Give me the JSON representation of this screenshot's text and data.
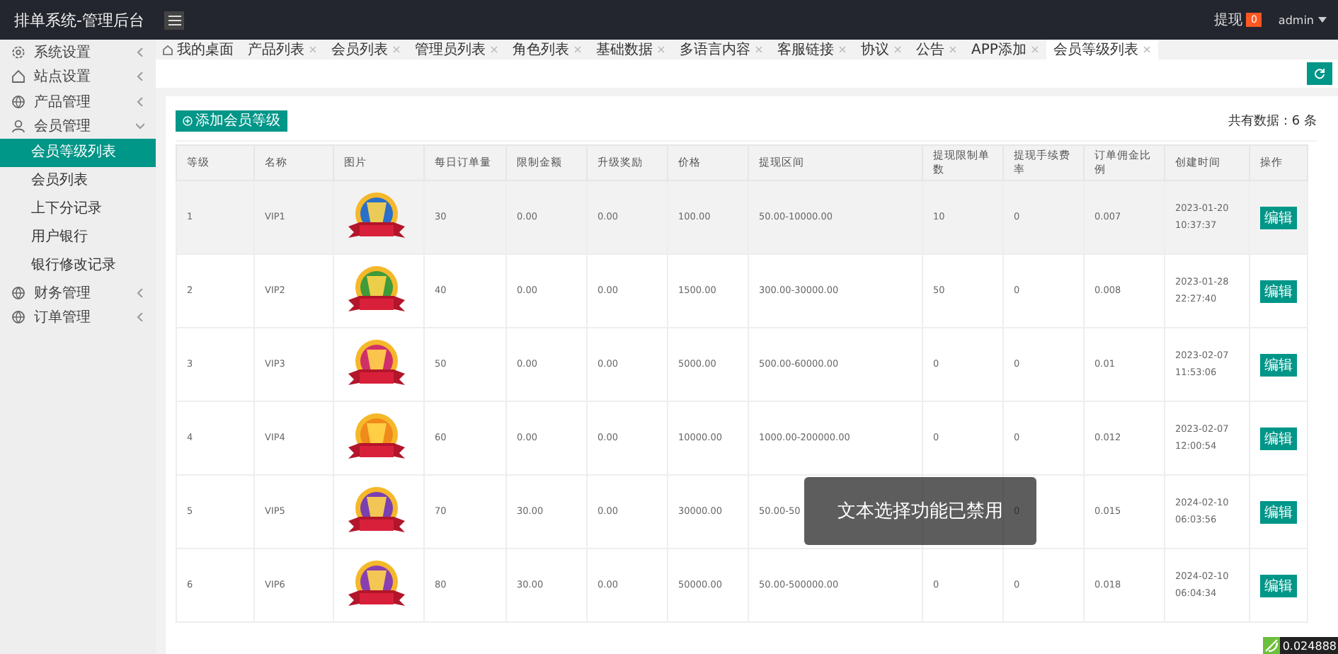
{
  "header": {
    "title": "排单系统-管理后台",
    "withdraw_label": "提现",
    "withdraw_badge": "0",
    "user": "admin"
  },
  "sidebar": {
    "items": [
      {
        "label": "系统设置",
        "expanded": false
      },
      {
        "label": "站点设置",
        "expanded": false
      },
      {
        "label": "产品管理",
        "expanded": false
      },
      {
        "label": "会员管理",
        "expanded": true,
        "children": [
          {
            "label": "会员等级列表",
            "selected": true
          },
          {
            "label": "会员列表",
            "selected": false
          },
          {
            "label": "上下分记录",
            "selected": false
          },
          {
            "label": "用户银行",
            "selected": false
          },
          {
            "label": "银行修改记录",
            "selected": false
          }
        ]
      },
      {
        "label": "财务管理",
        "expanded": false
      },
      {
        "label": "订单管理",
        "expanded": false
      }
    ]
  },
  "tabs": [
    {
      "label": "我的桌面",
      "selected": false,
      "closable": false
    },
    {
      "label": "产品列表",
      "selected": false,
      "closable": true
    },
    {
      "label": "会员列表",
      "selected": false,
      "closable": true
    },
    {
      "label": "管理员列表",
      "selected": false,
      "closable": true
    },
    {
      "label": "角色列表",
      "selected": false,
      "closable": true
    },
    {
      "label": "基础数据",
      "selected": false,
      "closable": true
    },
    {
      "label": "多语言内容",
      "selected": false,
      "closable": true
    },
    {
      "label": "客服链接",
      "selected": false,
      "closable": true
    },
    {
      "label": "协议",
      "selected": false,
      "closable": true
    },
    {
      "label": "公告",
      "selected": false,
      "closable": true
    },
    {
      "label": "APP添加",
      "selected": false,
      "closable": true
    },
    {
      "label": "会员等级列表",
      "selected": true,
      "closable": true
    }
  ],
  "add_button": "添加会员等级",
  "total": "共有数据：6 条",
  "table": {
    "columns": [
      "等级",
      "名称",
      "图片",
      "每日订单量",
      "限制金额",
      "升级奖励",
      "价格",
      "提现区间",
      "提现限制单数",
      "提现手续费率",
      "订单佣金比例",
      "创建时间",
      "操作"
    ],
    "rows": [
      {
        "selected": true,
        "level": "1",
        "name": "VIP1",
        "color": "#2a6fc9",
        "daily_orders": "30",
        "limit_amount": "0.00",
        "upgrade_reward": "0.00",
        "price": "100.00",
        "withdraw_range": "50.00-10000.00",
        "withdraw_limit_count": "10",
        "withdraw_fee_rate": "0",
        "commission_rate": "0.007",
        "created_at": "2023-01-20 10:37:37",
        "action": "编辑"
      },
      {
        "selected": false,
        "level": "2",
        "name": "VIP2",
        "color": "#3f9a3a",
        "daily_orders": "40",
        "limit_amount": "0.00",
        "upgrade_reward": "0.00",
        "price": "1500.00",
        "withdraw_range": "300.00-30000.00",
        "withdraw_limit_count": "50",
        "withdraw_fee_rate": "0",
        "commission_rate": "0.008",
        "created_at": "2023-01-28 22:27:40",
        "action": "编辑"
      },
      {
        "selected": false,
        "level": "3",
        "name": "VIP3",
        "color": "#d0306a",
        "daily_orders": "50",
        "limit_amount": "0.00",
        "upgrade_reward": "0.00",
        "price": "5000.00",
        "withdraw_range": "500.00-60000.00",
        "withdraw_limit_count": "0",
        "withdraw_fee_rate": "0",
        "commission_rate": "0.01",
        "created_at": "2023-02-07 11:53:06",
        "action": "编辑"
      },
      {
        "selected": false,
        "level": "4",
        "name": "VIP4",
        "color": "#f08a1a",
        "daily_orders": "60",
        "limit_amount": "0.00",
        "upgrade_reward": "0.00",
        "price": "10000.00",
        "withdraw_range": "1000.00-200000.00",
        "withdraw_limit_count": "0",
        "withdraw_fee_rate": "0",
        "commission_rate": "0.012",
        "created_at": "2023-02-07 12:00:54",
        "action": "编辑"
      },
      {
        "selected": false,
        "level": "5",
        "name": "VIP5",
        "color": "#7a3fb0",
        "daily_orders": "70",
        "limit_amount": "30.00",
        "upgrade_reward": "0.00",
        "price": "30000.00",
        "withdraw_range": "50.00-50",
        "withdraw_fee_rate": "0",
        "commission_rate": "0.015",
        "created_at": "2024-02-10 06:03:56",
        "action": "编辑"
      },
      {
        "selected": false,
        "level": "6",
        "name": "VIP6",
        "color": "#8a3fb0",
        "daily_orders": "80",
        "limit_amount": "30.00",
        "upgrade_reward": "0.00",
        "price": "50000.00",
        "withdraw_range": "50.00-500000.00",
        "withdraw_limit_count": "0",
        "withdraw_fee_rate": "0",
        "commission_rate": "0.018",
        "created_at": "2024-02-10 06:04:34",
        "action": "编辑"
      }
    ]
  },
  "toast": "文本选择功能已禁用",
  "corner_reading": "0.024888"
}
